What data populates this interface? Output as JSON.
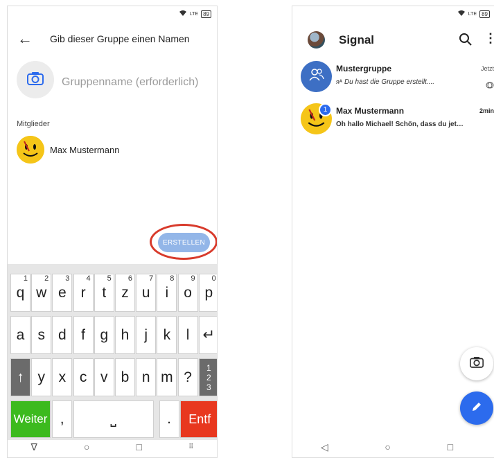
{
  "left": {
    "status_battery": "89",
    "status_signal": "LTE",
    "header_title": "Gib dieser Gruppe einen Namen",
    "group_name_placeholder": "Gruppenname (erforderlich)",
    "members_label": "Mitglieder",
    "member_name": "Max Mustermann",
    "create_button": "ERSTELLEN",
    "keyboard": {
      "row1": [
        {
          "k": "q",
          "n": "1"
        },
        {
          "k": "w",
          "n": "2"
        },
        {
          "k": "e",
          "n": "3"
        },
        {
          "k": "r",
          "n": "4"
        },
        {
          "k": "t",
          "n": "5"
        },
        {
          "k": "z",
          "n": "6"
        },
        {
          "k": "u",
          "n": "7"
        },
        {
          "k": "i",
          "n": "8"
        },
        {
          "k": "o",
          "n": "9"
        },
        {
          "k": "p",
          "n": "0"
        }
      ],
      "row2": [
        "a",
        "s",
        "d",
        "f",
        "g",
        "h",
        "j",
        "k",
        "l"
      ],
      "row3": [
        "y",
        "x",
        "c",
        "v",
        "b",
        "n",
        "m",
        "?"
      ],
      "enter_symbol": "↵",
      "shift_symbol": "↑",
      "numbers_symbol": "1 2 3",
      "weiter": "Weiter",
      "comma": ",",
      "space_symbol": "⎵",
      "period": ".",
      "entf": "Entf"
    },
    "nav": {
      "back": "∇",
      "home": "○",
      "recents": "□",
      "kbd": "⠿"
    }
  },
  "right": {
    "status_battery": "89",
    "status_signal": "LTE",
    "app_title": "Signal",
    "conversations": [
      {
        "name": "Mustergruppe",
        "message": "Du hast die Gruppe erstellt....",
        "time": "Jetzt"
      },
      {
        "name": "Max Mustermann",
        "message": "Oh hallo Michael! Schön, dass du jet…",
        "time": "2min",
        "badge": "1"
      }
    ],
    "nav": {
      "back": "◁",
      "home": "○",
      "recents": "□"
    }
  },
  "colors": {
    "accent": "#2c6bed",
    "create_btn": "#93b6e8",
    "highlight": "#d83a2b",
    "weiter": "#3cba1e",
    "entf": "#e8381f"
  }
}
